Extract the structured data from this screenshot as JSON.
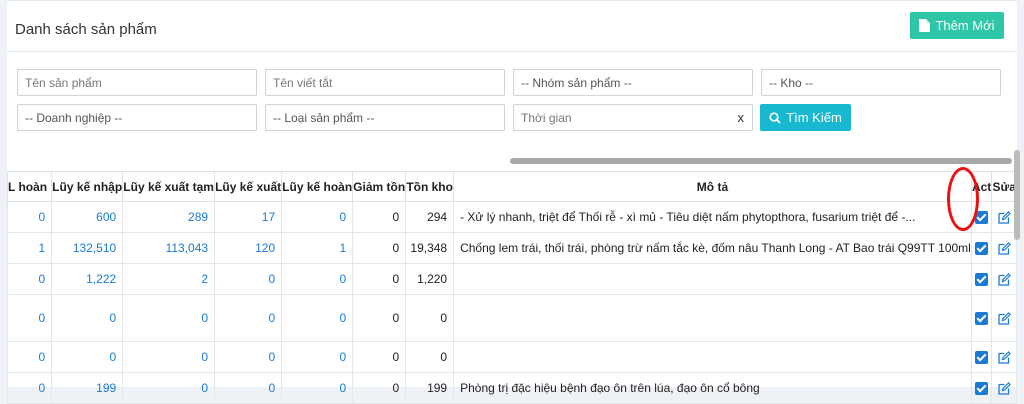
{
  "header": {
    "title": "Danh sách sản phẩm",
    "add_label": "Thêm Mới"
  },
  "filters": {
    "product_name_placeholder": "Tên sản phẩm",
    "short_name_placeholder": "Tên viết tắt",
    "product_group": "-- Nhóm sản phẩm --",
    "warehouse": "-- Kho --",
    "company": "-- Doanh nghiệp --",
    "product_type": "-- Loại sản phẩm --",
    "time_placeholder": "Thời gian",
    "clear": "x",
    "search_label": "Tìm Kiếm"
  },
  "table": {
    "headers": [
      "L hoàn",
      "Lũy kế nhập",
      "Lũy kế xuất tạm",
      "Lũy kế xuất",
      "Lũy kế hoàn",
      "Giảm tồn",
      "Tồn kho",
      "Mô tả",
      "Act",
      "Sửa"
    ],
    "rows": [
      [
        "0",
        "600",
        "289",
        "17",
        "0",
        "0",
        "294",
        "- Xử lý nhanh, triệt để Thối rễ - xì mủ - Tiêu diệt nấm phytopthora, fusarium triệt để -..."
      ],
      [
        "1",
        "132,510",
        "113,043",
        "120",
        "1",
        "0",
        "19,348",
        "Chống lem trái, thối trái, phòng trừ nấm tắc kè, đốm nâu Thanh Long - AT Bao trái Q99TT 100ml"
      ],
      [
        "0",
        "1,222",
        "2",
        "0",
        "0",
        "0",
        "1,220",
        ""
      ],
      [
        "0",
        "0",
        "0",
        "0",
        "0",
        "0",
        "0",
        ""
      ],
      [
        "0",
        "0",
        "0",
        "0",
        "0",
        "0",
        "0",
        ""
      ],
      [
        "0",
        "199",
        "0",
        "0",
        "0",
        "0",
        "199",
        "Phòng trị đặc hiệu bệnh đạo ôn trên lúa, đạo ôn cổ bông"
      ]
    ]
  }
}
